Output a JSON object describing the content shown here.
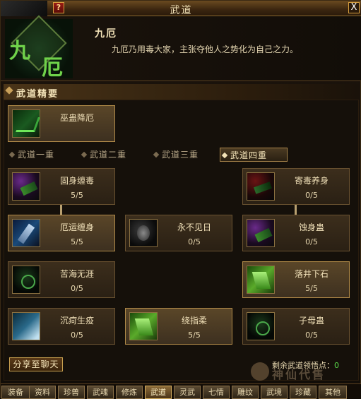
{
  "window": {
    "title": "武道",
    "help_label": "?",
    "close_label": "X"
  },
  "header": {
    "emblem_chars": [
      "九",
      "厄"
    ],
    "skill_name": "九厄",
    "skill_desc": "九厄乃用毒大家，主张夺他人之势化为自己之力。"
  },
  "essence": {
    "label": "武道精要",
    "card": {
      "name": "巫蛊降厄",
      "icon": "sparkle-green-icon"
    }
  },
  "tabs": [
    {
      "label": "武道一重",
      "active": false
    },
    {
      "label": "武道二重",
      "active": false
    },
    {
      "label": "武道三重",
      "active": false
    },
    {
      "label": "武道四重",
      "active": true
    }
  ],
  "skills": [
    {
      "name": "固身缠毒",
      "level": "5/5",
      "icon": "serpent-purple-icon",
      "lit": false
    },
    {
      "name": "寄毒养身",
      "level": "0/5",
      "icon": "serpent-red-icon",
      "lit": false
    },
    {
      "name": "厄运缠身",
      "level": "5/5",
      "icon": "blue-arm-icon",
      "lit": true
    },
    {
      "name": "永不见日",
      "level": "0/5",
      "icon": "gray-beast-icon",
      "lit": false
    },
    {
      "name": "蚀身蛊",
      "level": "0/5",
      "icon": "purple-arm-icon",
      "lit": false
    },
    {
      "name": "苦海无涯",
      "level": "0/5",
      "icon": "dark-beast-icon",
      "lit": false
    },
    {
      "name": "落井下石",
      "level": "5/5",
      "icon": "green-figure-icon",
      "lit": true
    },
    {
      "name": "沉疴生疫",
      "level": "0/5",
      "icon": "teal-wave-icon",
      "lit": false
    },
    {
      "name": "绕指柔",
      "level": "5/5",
      "icon": "green-hand-icon",
      "lit": true
    },
    {
      "name": "子母蛊",
      "level": "0/5",
      "icon": "green-orb-icon",
      "lit": false
    }
  ],
  "share_label": "分享至聊天",
  "remain": {
    "label": "剩余武道领悟点：",
    "value": "0"
  },
  "watermark": "神仙代售",
  "bottom_tabs": [
    {
      "label": "装备",
      "active": false
    },
    {
      "label": "资料",
      "active": false
    },
    {
      "label": "珍兽",
      "active": false
    },
    {
      "label": "武魂",
      "active": false
    },
    {
      "label": "修炼",
      "active": false
    },
    {
      "label": "武道",
      "active": true
    },
    {
      "label": "灵武",
      "active": false
    },
    {
      "label": "七情",
      "active": false
    },
    {
      "label": "雕纹",
      "active": false
    },
    {
      "label": "武境",
      "active": false
    },
    {
      "label": "珍藏",
      "active": false
    },
    {
      "label": "其他",
      "active": false
    }
  ]
}
